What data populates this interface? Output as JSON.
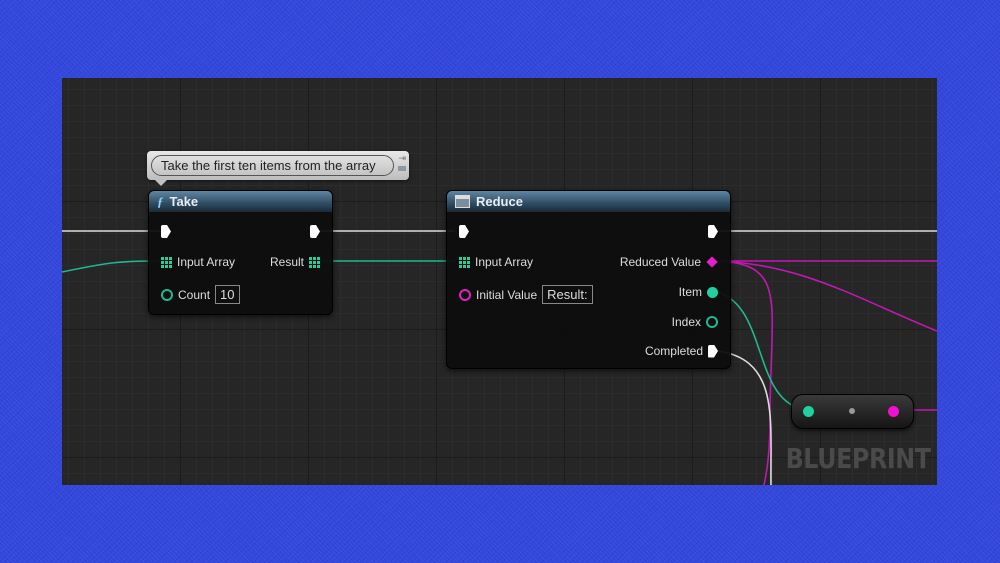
{
  "comment": {
    "text": "Take the first ten items from the array"
  },
  "take_node": {
    "title": "Take",
    "icon": "function-icon",
    "pins": {
      "input_array": "Input Array",
      "result": "Result",
      "count": "Count",
      "count_value": "10"
    }
  },
  "reduce_node": {
    "title": "Reduce",
    "icon": "macro-icon",
    "pins": {
      "input_array": "Input Array",
      "initial_value": "Initial Value",
      "initial_value_input": "Result:",
      "reduced_value": "Reduced Value",
      "item": "Item",
      "index": "Index",
      "completed": "Completed"
    }
  },
  "watermark": "BLUEPRINT",
  "colors": {
    "exec": "#ffffff",
    "array": "#1fd0a0",
    "struct": "#e020c8",
    "background": "#3347dd"
  }
}
